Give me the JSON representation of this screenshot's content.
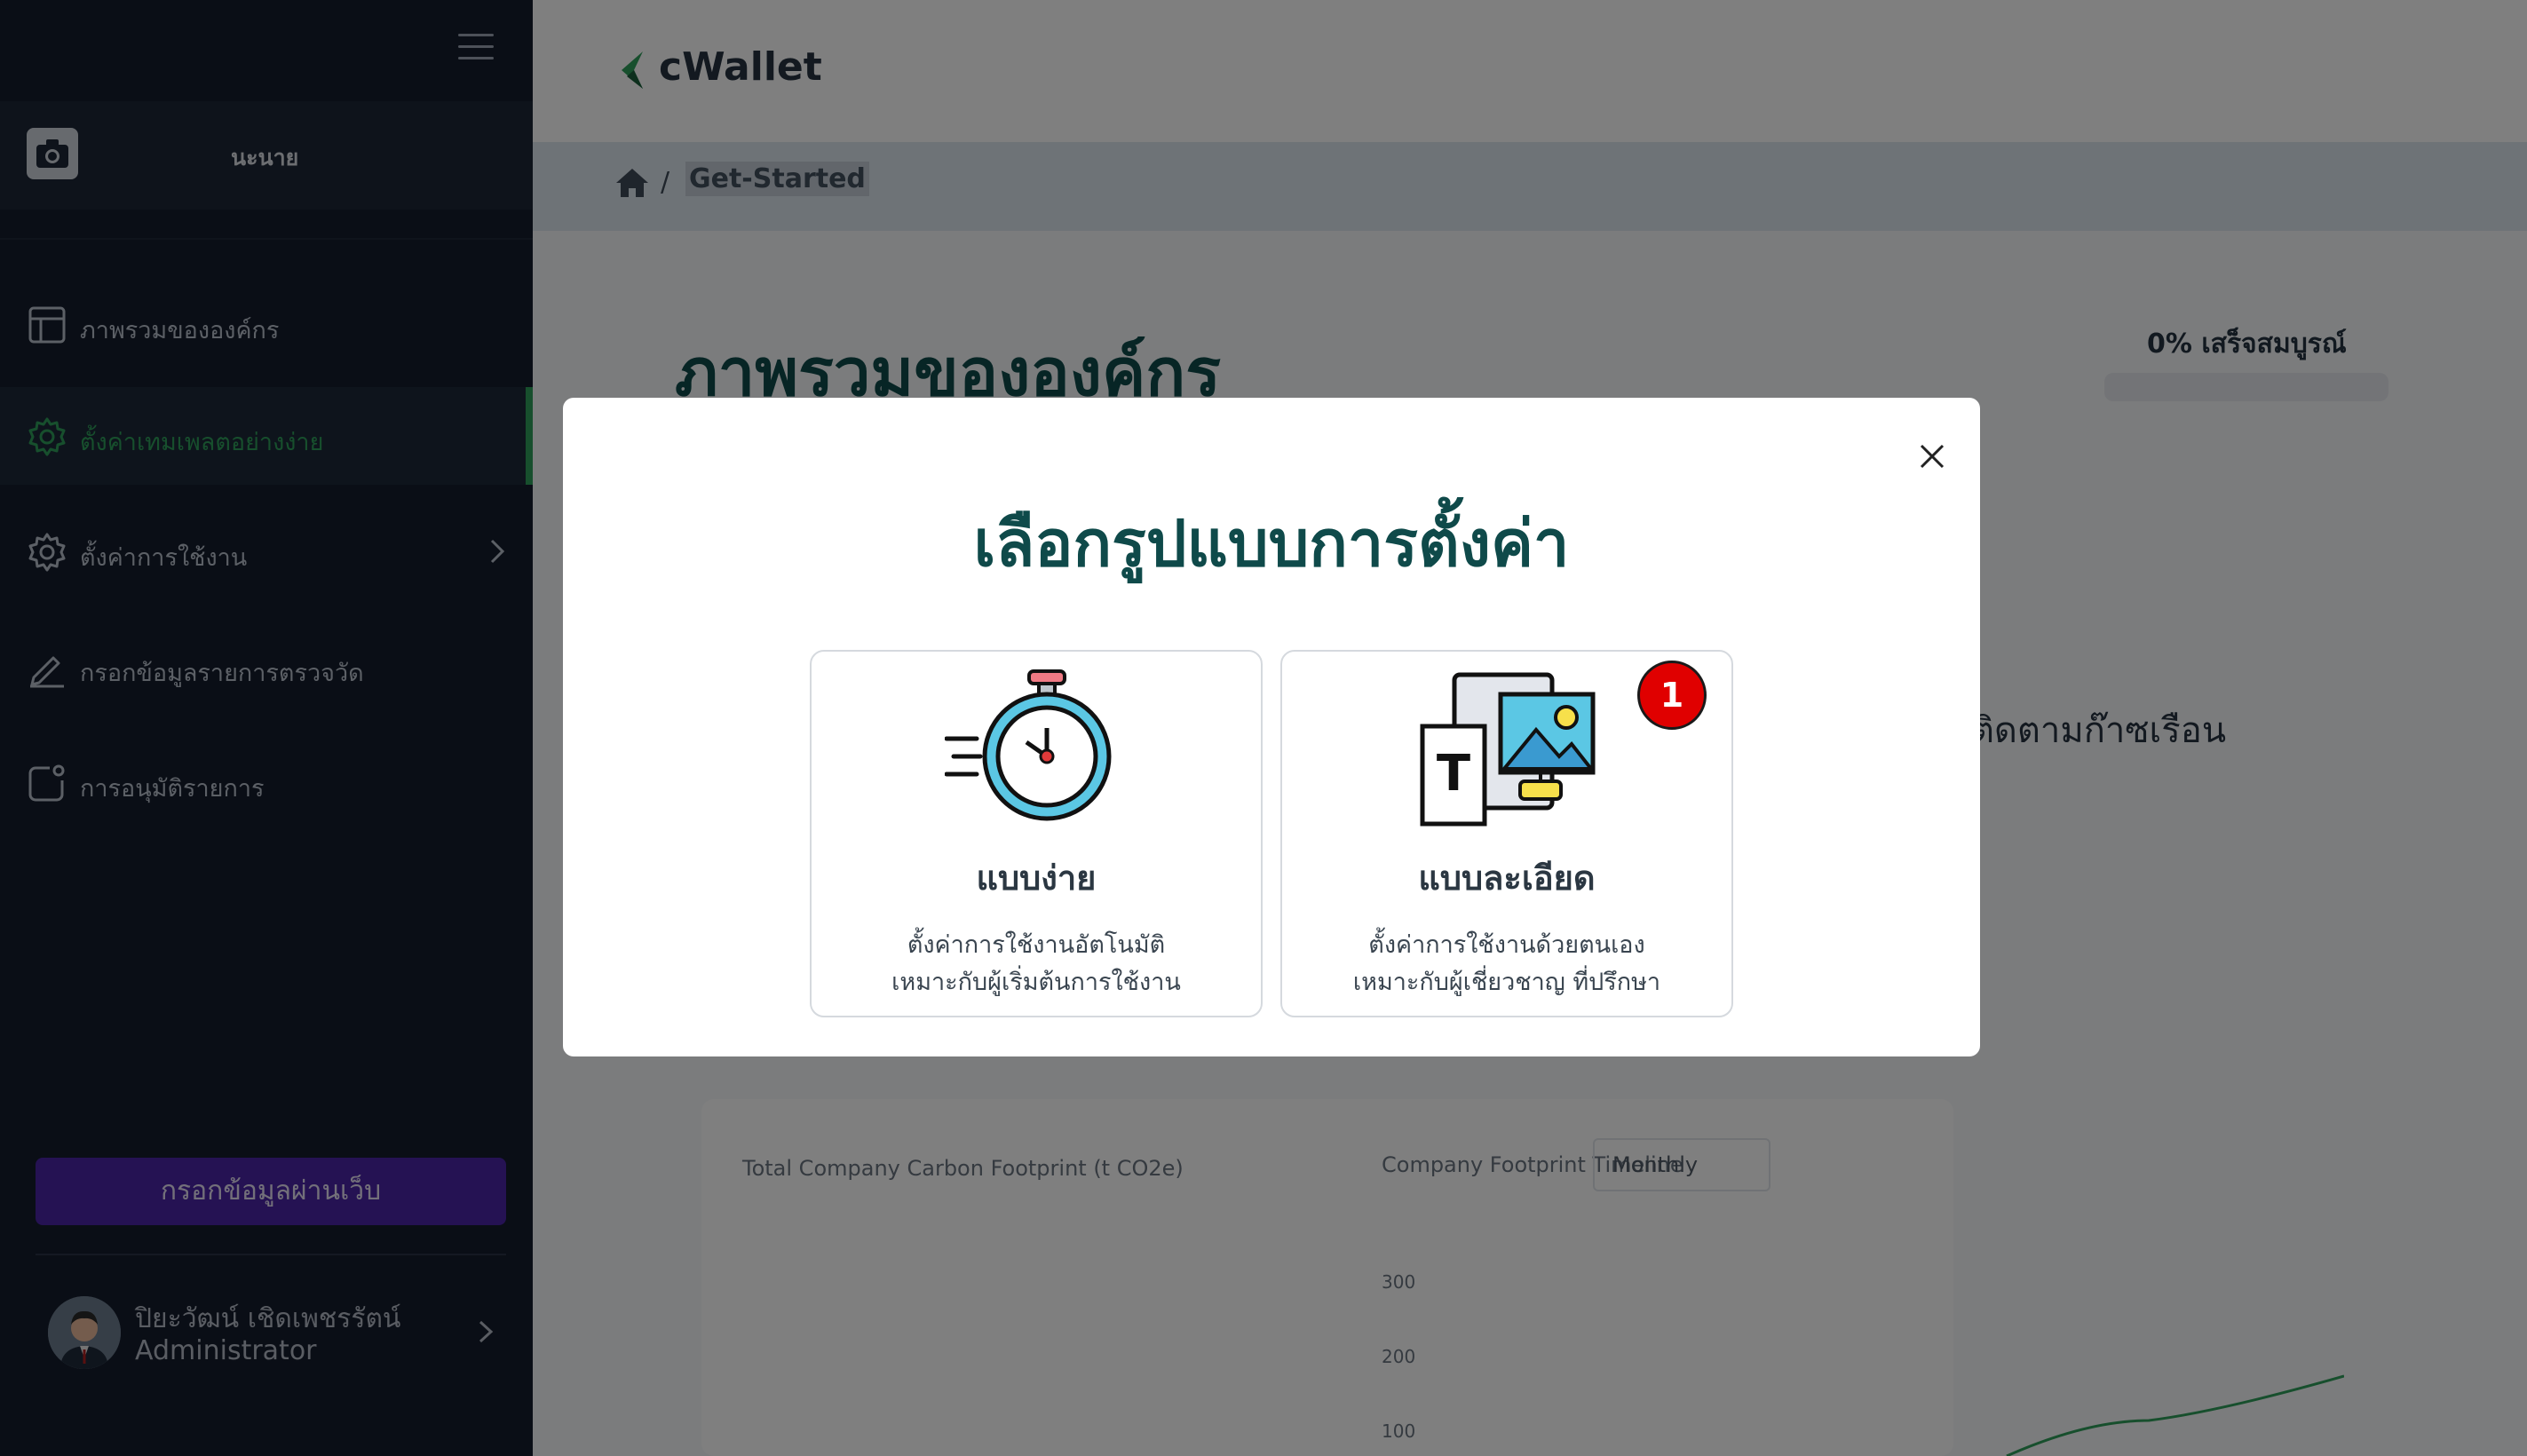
{
  "sidebar": {
    "org_name": "นะนาย",
    "items": [
      {
        "label": "ภาพรวมขององค์กร"
      },
      {
        "label": "ตั้งค่าเทมเพลตอย่างง่าย"
      },
      {
        "label": "ตั้งค่าการใช้งาน"
      },
      {
        "label": "กรอกข้อมูลรายการตรวจวัด"
      },
      {
        "label": "การอนุมัติรายการ"
      }
    ],
    "web_button": "กรอกข้อมูลผ่านเว็บ",
    "user": {
      "name": "ปิยะวัฒน์ เชิดเพชรรัตน์",
      "role": "Administrator"
    }
  },
  "header": {
    "logo_text": "cWallet"
  },
  "breadcrumb": {
    "separator": "/",
    "current": "Get-Started"
  },
  "page": {
    "title": "ภาพรวมขององค์กร",
    "progress_label": "0% เสร็จสมบูรณ์",
    "progress_value": 0,
    "info_text": "ารติดตามก๊าซเรือน",
    "chart_left_title": "Total Company Carbon Footprint (t CO2e)",
    "chart_right_title": "Company Footprint Timeline",
    "freq_select": "Monthly",
    "y_ticks": [
      "300",
      "200",
      "100"
    ]
  },
  "modal": {
    "title": "เลือกรูปแบบการตั้งค่า",
    "options": [
      {
        "title": "แบบง่าย",
        "desc1": "ตั้งค่าการใช้งานอัตโนมัติ",
        "desc2": "เหมาะกับผู้เริ่มต้นการใช้งาน"
      },
      {
        "title": "แบบละเอียด",
        "desc1": "ตั้งค่าการใช้งานด้วยตนเอง",
        "desc2": "เหมาะกับผู้เชี่ยวชาญ ที่ปรึกษา",
        "badge": "1"
      }
    ]
  },
  "colors": {
    "sidebar_bg": "#141c2c",
    "accent_green": "#2f9e5b",
    "primary_teal": "#0f4a4a",
    "button_purple": "#4b24a6",
    "badge_red": "#e00000"
  },
  "icons": {
    "menu": "hamburger-icon",
    "org": "camera-icon",
    "overview": "layout-icon",
    "template": "gear-icon",
    "settings": "gear-icon",
    "measure": "pencil-icon",
    "approval": "notification-square-icon",
    "home": "home-icon",
    "close": "close-icon",
    "simple": "stopwatch-icon",
    "detailed": "devices-icon"
  }
}
